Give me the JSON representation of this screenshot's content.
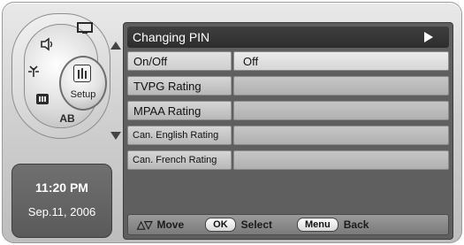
{
  "sidebar": {
    "icons": {
      "tv": "tv-icon",
      "sound": "sound-icon",
      "antenna": "antenna-icon",
      "parental": "parental-lock-icon",
      "ab": "ab-icon"
    },
    "ab_label": "AB",
    "setup_label": "Setup"
  },
  "clock": {
    "time": "11:20 PM",
    "date": "Sep.11, 2006"
  },
  "menu": {
    "title": "Changing PIN",
    "rows": [
      {
        "label": "On/Off",
        "value": "Off"
      },
      {
        "label": "TVPG Rating",
        "value": ""
      },
      {
        "label": "MPAA Rating",
        "value": ""
      },
      {
        "label": "Can. English Rating",
        "value": ""
      },
      {
        "label": "Can. French Rating",
        "value": ""
      }
    ]
  },
  "footer": {
    "move_icon": "△▽",
    "move_label": "Move",
    "ok_key": "OK",
    "select_label": "Select",
    "menu_key": "Menu",
    "back_label": "Back"
  },
  "colors": {
    "panel_background": "#5f5f5f",
    "title_bar": "#2d2d2d",
    "row_highlight": "#ececec"
  }
}
